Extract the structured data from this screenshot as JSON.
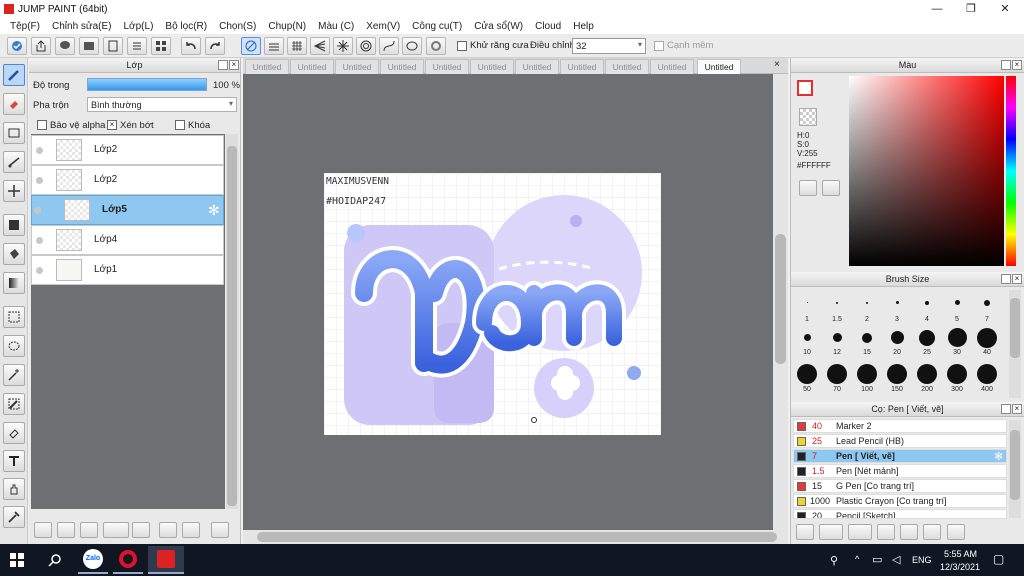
{
  "window": {
    "title": "JUMP PAINT (64bit)"
  },
  "menu": [
    "Tệp(F)",
    "Chỉnh sửa(E)",
    "Lớp(L)",
    "Bộ lọc(R)",
    "Chọn(S)",
    "Chụp(N)",
    "Màu (C)",
    "Xem(V)",
    "Công cụ(T)",
    "Cửa sổ(W)",
    "Cloud",
    "Help"
  ],
  "toolbar": {
    "antialias_label": "Khử răng cưa",
    "adjust_label": "Điều chỉnh",
    "adjust_value": "32",
    "snap_label": "Cạnh mềm"
  },
  "layer_panel": {
    "title": "Lớp",
    "opacity_label": "Độ trong",
    "opacity_value": "100 %",
    "blend_label": "Pha trộn",
    "blend_value": "Bình thường",
    "protect_alpha": "Bảo vệ alpha",
    "clipping": "Xén bớt",
    "lock": "Khóa",
    "layers": [
      "Lớp2",
      "Lớp2",
      "Lớp5",
      "Lớp4",
      "Lớp1"
    ],
    "selected_index": 2
  },
  "tabs": [
    "Untitled",
    "Untitled",
    "Untitled",
    "Untitled",
    "Untitled",
    "Untitled",
    "Untitled",
    "Untitled",
    "Untitled",
    "Untitled",
    "Untitled"
  ],
  "canvas": {
    "watermark_line1": "MAXIMUSVENN",
    "watermark_line2": "#HOIDAP247",
    "art_text": "Yam"
  },
  "color_panel": {
    "title": "Màu",
    "h": "H:0",
    "s": "S:0",
    "v": "V:255",
    "hex": "#FFFFFF"
  },
  "brush_size_panel": {
    "title": "Brush Size",
    "sizes": [
      "1",
      "1.5",
      "2",
      "3",
      "4",
      "5",
      "7",
      "10",
      "12",
      "15",
      "20",
      "25",
      "30",
      "40",
      "50",
      "70",
      "100",
      "150",
      "200",
      "300",
      "400"
    ]
  },
  "brush_panel": {
    "title": "Cọ: Pen [ Viết, vẽ]",
    "items": [
      {
        "size": "40",
        "name": "Marker 2",
        "color": "#e53935"
      },
      {
        "size": "25",
        "name": "Lead Pencil (HB)",
        "color": "#f2d12e"
      },
      {
        "size": "7",
        "name": "Pen [ Viết, vẽ]",
        "color": "#222222"
      },
      {
        "size": "1.5",
        "name": "Pen [Nét mảnh]",
        "color": "#222222"
      },
      {
        "size": "15",
        "name": "G Pen [Co trang trí]",
        "color": "#e53935"
      },
      {
        "size": "1000",
        "name": "Plastic Crayon [Co trang trí]",
        "color": "#f2d12e"
      },
      {
        "size": "20",
        "name": "Pencil [Sketch]",
        "color": "#222222"
      }
    ],
    "selected_index": 2
  },
  "taskbar": {
    "time": "5:55 AM",
    "date": "12/3/2021",
    "lang": "ENG",
    "zalo": "Zalo"
  }
}
